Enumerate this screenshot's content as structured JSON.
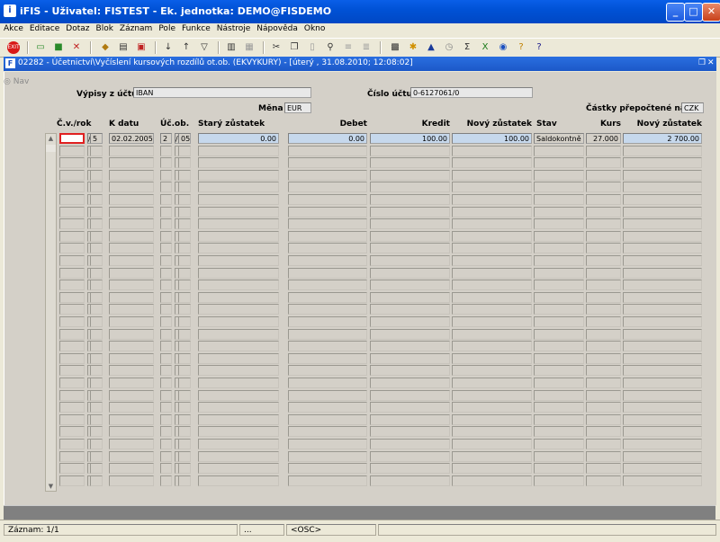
{
  "app": {
    "window_title": "iFIS - Uživatel: FISTEST - Ek. jednotka: DEMO@FISDEMO"
  },
  "menu": [
    "Akce",
    "Editace",
    "Dotaz",
    "Blok",
    "Záznam",
    "Pole",
    "Funkce",
    "Nástroje",
    "Nápověda",
    "Okno"
  ],
  "inner_window": {
    "title": "02282 - Účetnictví\\Vyčíslení kursových rozdílů ot.ob. (EKVYKURY) - [úterý , 31.08.2010; 12:08:02]"
  },
  "nav_label": "Nav",
  "header": {
    "vypisy_label": "Výpisy z účtu",
    "vypisy_value": "IBAN",
    "cislo_uctu_label": "Číslo účtu",
    "cislo_uctu_value": "0-6127061/0",
    "mena_label": "Měna",
    "mena_value": "EUR",
    "castky_label": "Částky přepočtené na",
    "castky_value": "CZK"
  },
  "columns": {
    "cv_rok": "Č.v./rok",
    "k_datu": "K datu",
    "uc_ob": "Úč.ob.",
    "stary": "Starý zůstatek",
    "debet": "Debet",
    "kredit": "Kredit",
    "novy": "Nový zůstatek",
    "stav": "Stav",
    "kurs": "Kurs",
    "novy2": "Nový zůstatek"
  },
  "row1": {
    "cv": "",
    "slash": "/",
    "rok": "5",
    "k_datu": "02.02.2005",
    "uc": "2",
    "ob_slash": "/",
    "ob": "05",
    "stary": "0.00",
    "debet": "0.00",
    "kredit": "100.00",
    "novy": "100.00",
    "stav": "Saldokontně v",
    "kurs": "27.000",
    "novy2": "2 700.00"
  },
  "status": {
    "zaznam": "Záznam: 1/1",
    "ellipsis": "...",
    "osc": "<OSC>"
  }
}
